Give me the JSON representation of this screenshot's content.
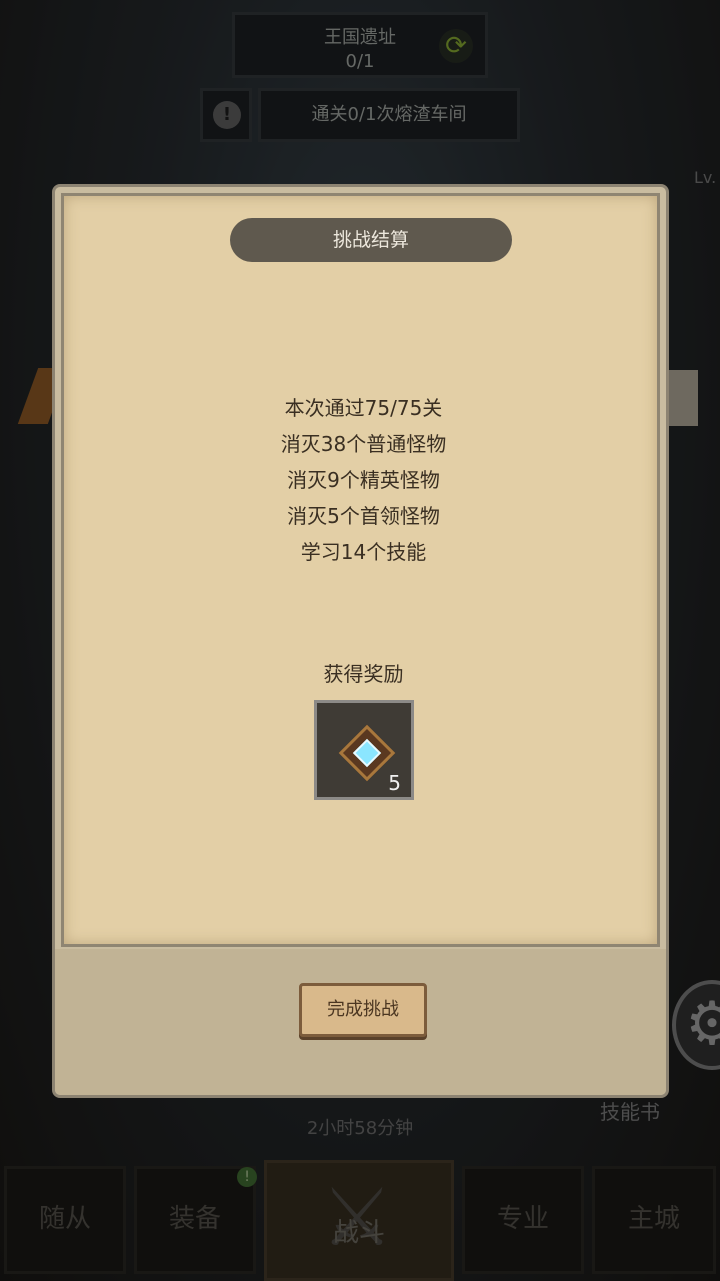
{
  "header": {
    "ruins_title": "王国遗址",
    "ruins_progress": "0/1",
    "quest_text": "通关0/1次熔渣车间",
    "alert_symbol": "!",
    "level_prefix": "Lv."
  },
  "modal": {
    "title": "挑战结算",
    "stats": [
      "本次通过75/75关",
      "消灭38个普通怪物",
      "消灭9个精英怪物",
      "消灭5个首领怪物",
      "学习14个技能"
    ],
    "reward_title": "获得奖励",
    "reward": {
      "icon": "gem-icon",
      "count": "5"
    },
    "confirm_label": "完成挑战"
  },
  "background": {
    "skill_book_label": "技能书",
    "timer_text": "2小时58分钟"
  },
  "bottom_nav": [
    {
      "label": "随从"
    },
    {
      "label": "装备",
      "badge": "!"
    },
    {
      "label": "战斗"
    },
    {
      "label": "专业"
    },
    {
      "label": "主城"
    }
  ],
  "colors": {
    "paper": "#e3cfa6",
    "title_bar": "#5f594e",
    "text_dark": "#3a2f22",
    "gem": "#8be6ff"
  }
}
